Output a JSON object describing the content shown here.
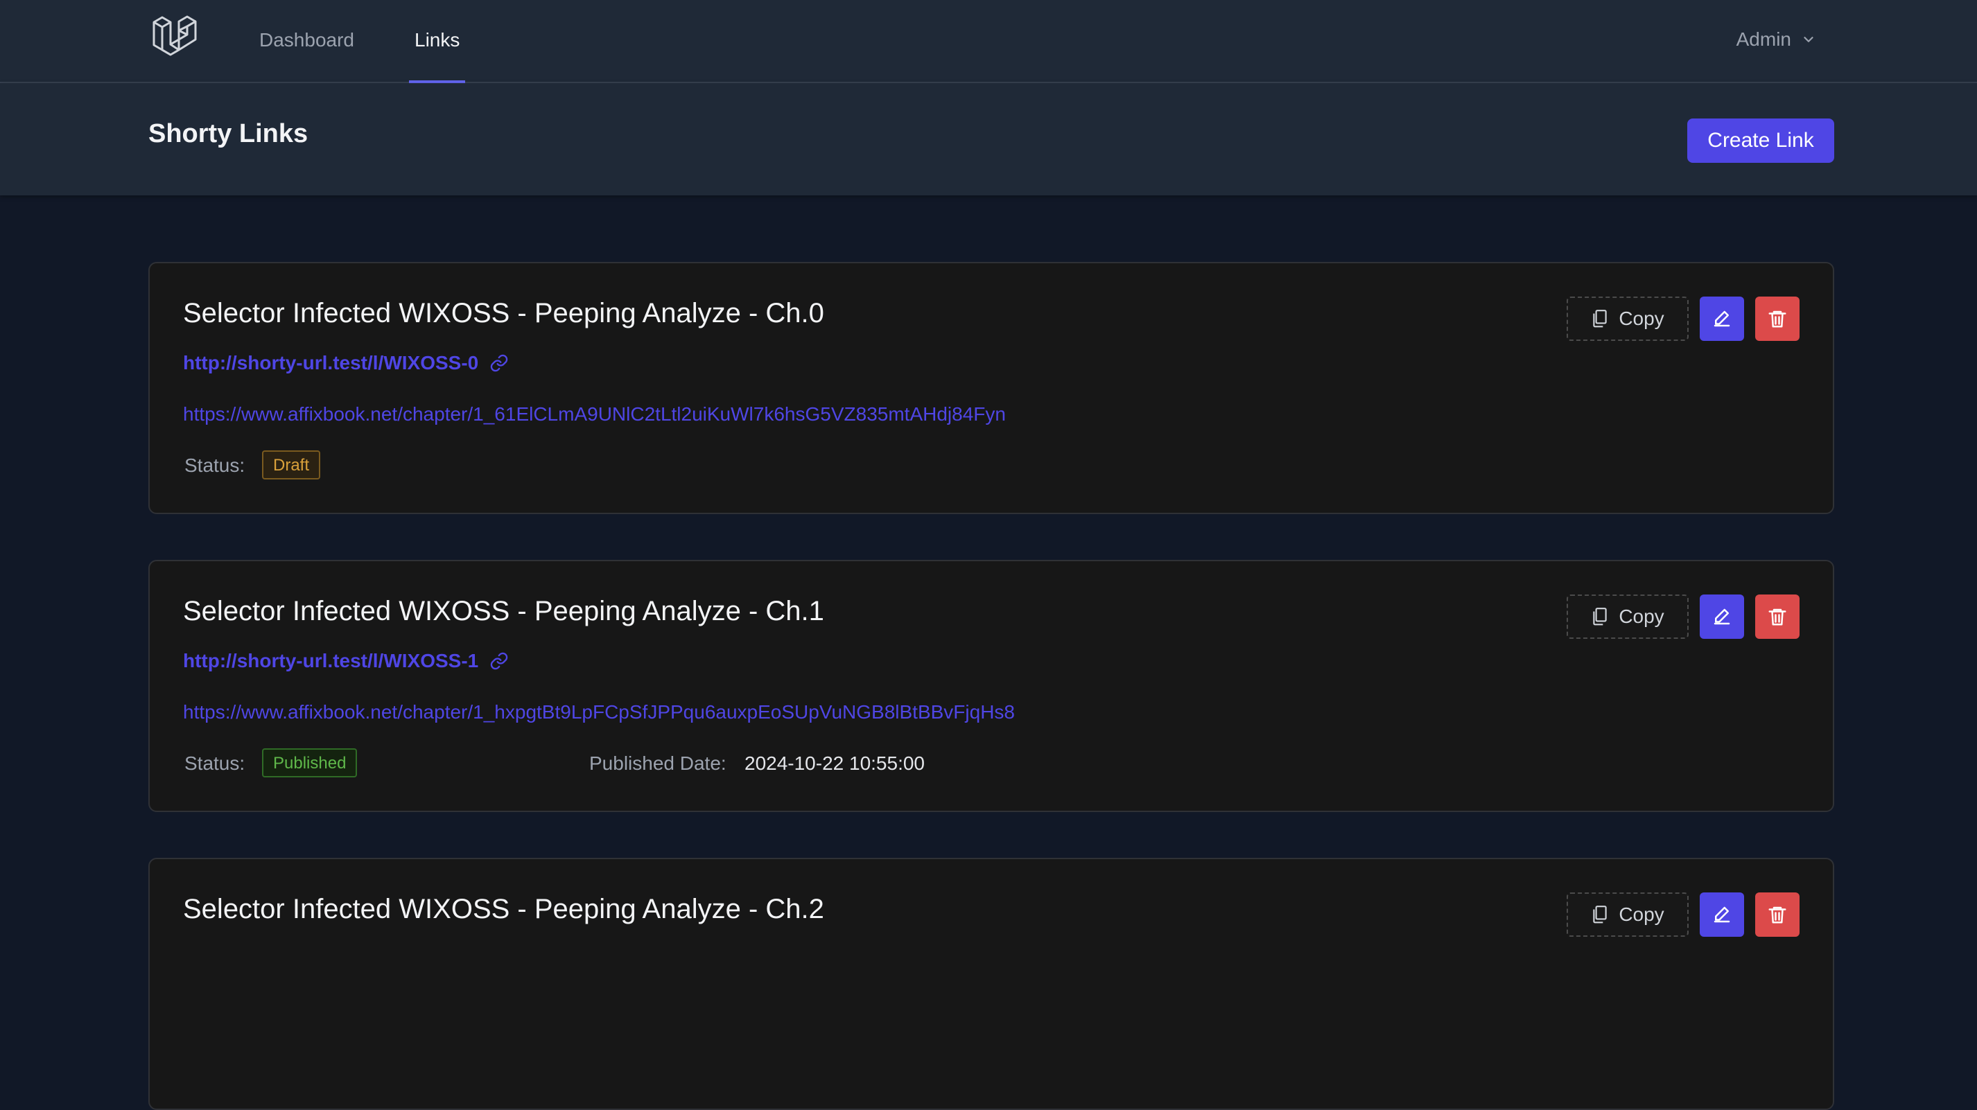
{
  "nav": {
    "logo_icon": "laravel-logo-icon",
    "items": [
      {
        "label": "Dashboard",
        "active": false
      },
      {
        "label": "Links",
        "active": true
      }
    ],
    "user": {
      "label": "Admin",
      "icon": "chevron-down-icon"
    }
  },
  "header": {
    "title": "Shorty Links",
    "create_label": "Create Link"
  },
  "colors": {
    "accent": "#4f46e5",
    "danger": "#dc4a4a",
    "draft": "#d9a13b",
    "published": "#5fb84a"
  },
  "links": [
    {
      "title": "Selector Infected WIXOSS - Peeping Analyze - Ch.0",
      "short_url": "http://shorty-url.test/l/WIXOSS-0",
      "long_url": "https://www.affixbook.net/chapter/1_61ElCLmA9UNlC2tLtl2uiKuWl7k6hsG5VZ835mtAHdj84Fyn",
      "status_label": "Status",
      "status": "Draft",
      "published_label": "",
      "published_date": "",
      "copy_label": "Copy"
    },
    {
      "title": "Selector Infected WIXOSS - Peeping Analyze - Ch.1",
      "short_url": "http://shorty-url.test/l/WIXOSS-1",
      "long_url": "https://www.affixbook.net/chapter/1_hxpgtBt9LpFCpSfJPPqu6auxpEoSUpVuNGB8lBtBBvFjqHs8",
      "status_label": "Status",
      "status": "Published",
      "published_label": "Published Date",
      "published_date": "2024-10-22 10:55:00",
      "copy_label": "Copy"
    },
    {
      "title": "Selector Infected WIXOSS - Peeping Analyze - Ch.2",
      "copy_label": "Copy"
    }
  ]
}
